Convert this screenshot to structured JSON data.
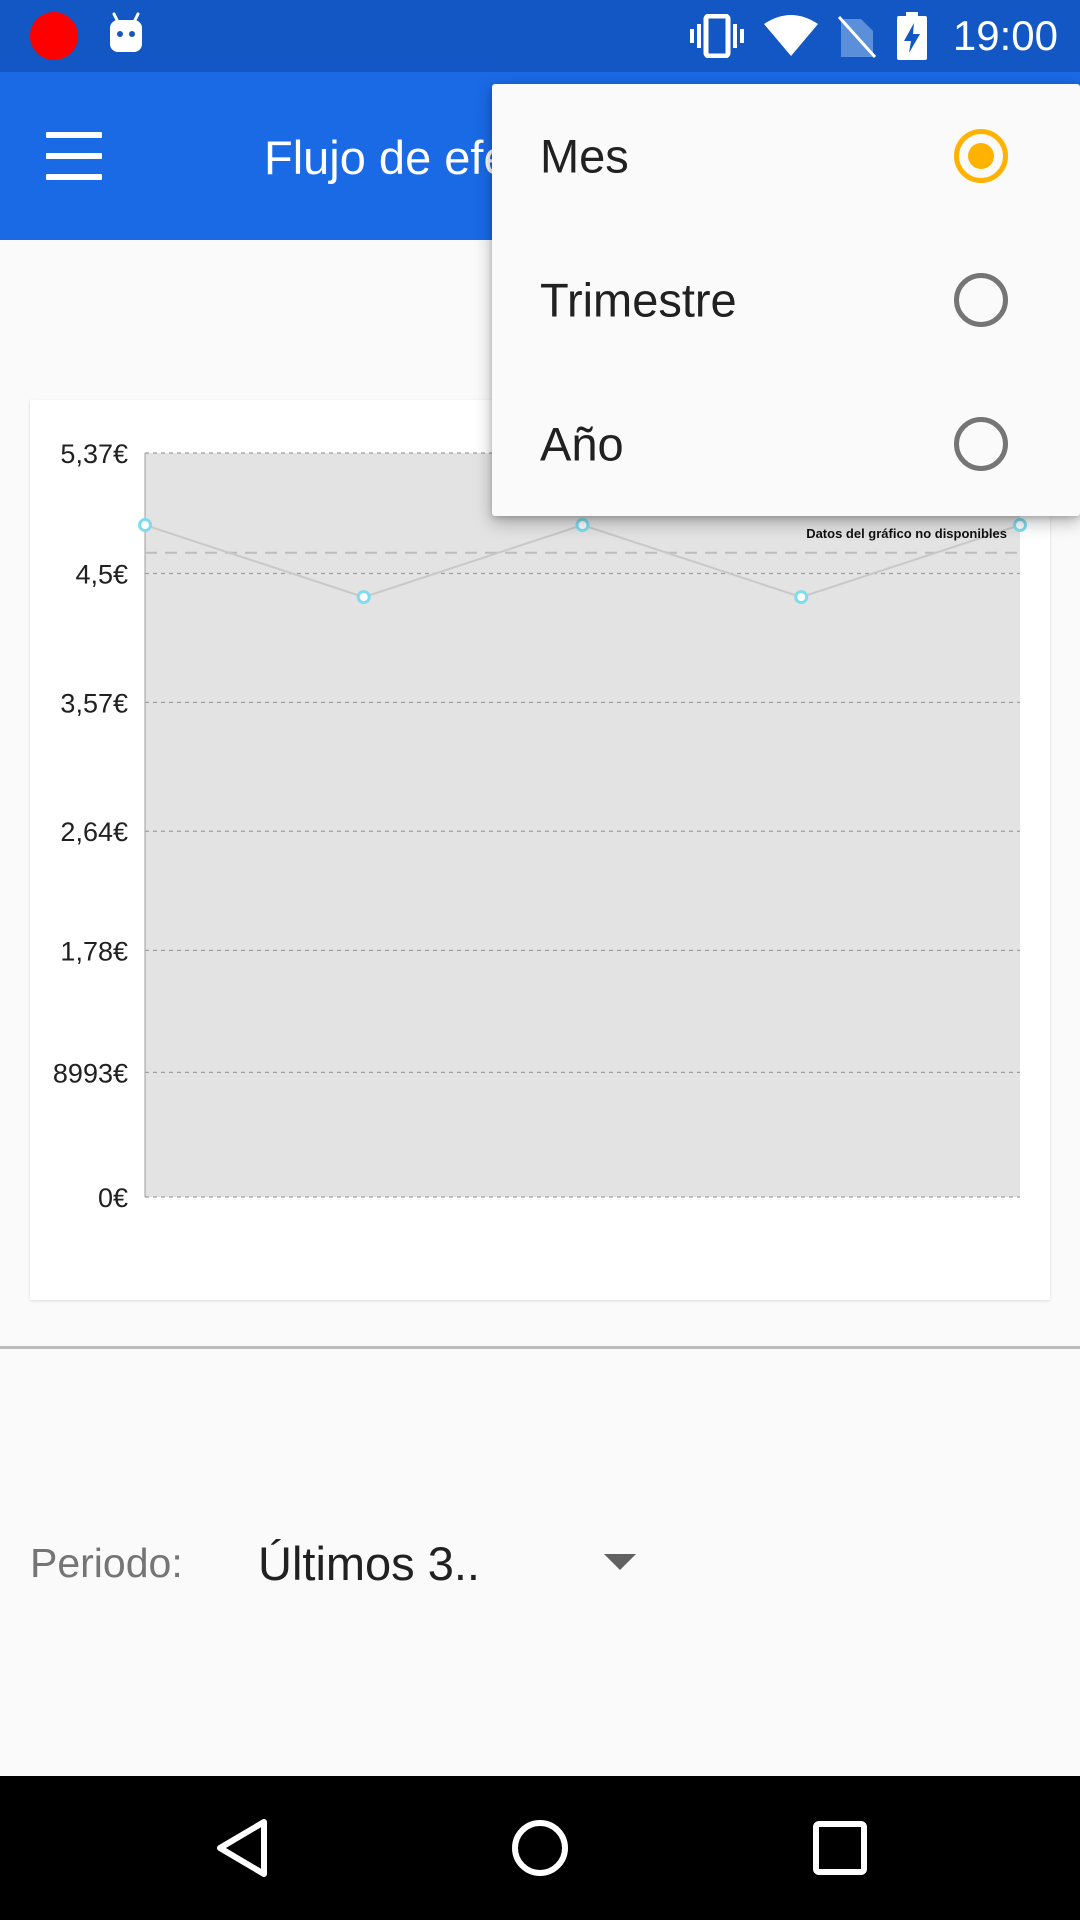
{
  "status_bar": {
    "time": "19:00",
    "icons": [
      "record-icon",
      "android-debug-icon",
      "vibrate-icon",
      "wifi-icon",
      "no-sim-icon",
      "battery-charging-icon"
    ],
    "record_color": "#ff0000"
  },
  "app_bar": {
    "title": "Flujo de efectivo",
    "menu_icon": "hamburger-menu-icon",
    "color": "#1a6ae6"
  },
  "popup_menu": {
    "options": [
      {
        "label": "Mes",
        "selected": true
      },
      {
        "label": "Trimestre",
        "selected": false
      },
      {
        "label": "Año",
        "selected": false
      }
    ],
    "accent": "#ffb300"
  },
  "chart_data": {
    "type": "line",
    "y_tick_labels": [
      "5,37€",
      "4,5€",
      "3,57€",
      "2,64€",
      "1,78€",
      "8993€",
      "0€"
    ],
    "y_tick_values": [
      5.37,
      4.5,
      3.57,
      2.64,
      1.78,
      0.8993,
      0
    ],
    "ylim": [
      0,
      5.37
    ],
    "points": [
      {
        "x": 0,
        "y": 4.85
      },
      {
        "x": 1,
        "y": 4.33
      },
      {
        "x": 2,
        "y": 4.85
      },
      {
        "x": 3,
        "y": 4.33
      },
      {
        "x": 4,
        "y": 4.85
      }
    ],
    "average_line": 4.65,
    "annotation": "Datos del gráfico no disponibles",
    "grid": true,
    "colors": {
      "fill": "#e3e3e3",
      "line": "#c8c8c8",
      "point": "#7fdcf0",
      "grid": "#9e9e9e"
    }
  },
  "period": {
    "label": "Periodo:",
    "value": "Últimos 3.."
  },
  "nav_bar": {
    "icons": [
      "back-icon",
      "home-icon",
      "recents-icon"
    ]
  }
}
